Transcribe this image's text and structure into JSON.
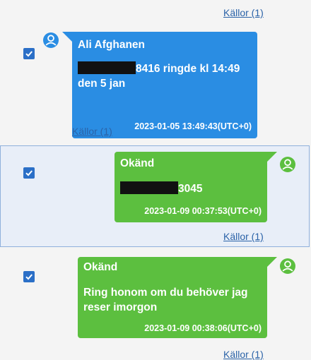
{
  "top": {
    "sources_link": "Källor (1)"
  },
  "messages": [
    {
      "sender": "Ali Afghanen",
      "text_line1": "8416  ringde kl 14:49",
      "text_line2": "den 5 jan",
      "timestamp": "2023-01-05 13:49:43(UTC+0)",
      "sources_link": "Källor (1)",
      "checked": true,
      "direction": "incoming",
      "color": "#2a8de3"
    },
    {
      "sender": "Okänd",
      "text_line1": "3045",
      "timestamp": "2023-01-09 00:37:53(UTC+0)",
      "sources_link": "Källor (1)",
      "checked": true,
      "direction": "outgoing",
      "selected": true,
      "color": "#5cbf3f"
    },
    {
      "sender": "Okänd",
      "text_line1": "Ring honom om du behöver jag",
      "text_line2": "reser imorgon",
      "timestamp": "2023-01-09 00:38:06(UTC+0)",
      "sources_link": "Källor (1)",
      "checked": true,
      "direction": "outgoing",
      "color": "#5cbf3f"
    }
  ],
  "colors": {
    "incoming": "#2a8de3",
    "outgoing": "#5cbf3f",
    "link": "#2b63a8",
    "checkbox": "#2b6fc7"
  }
}
